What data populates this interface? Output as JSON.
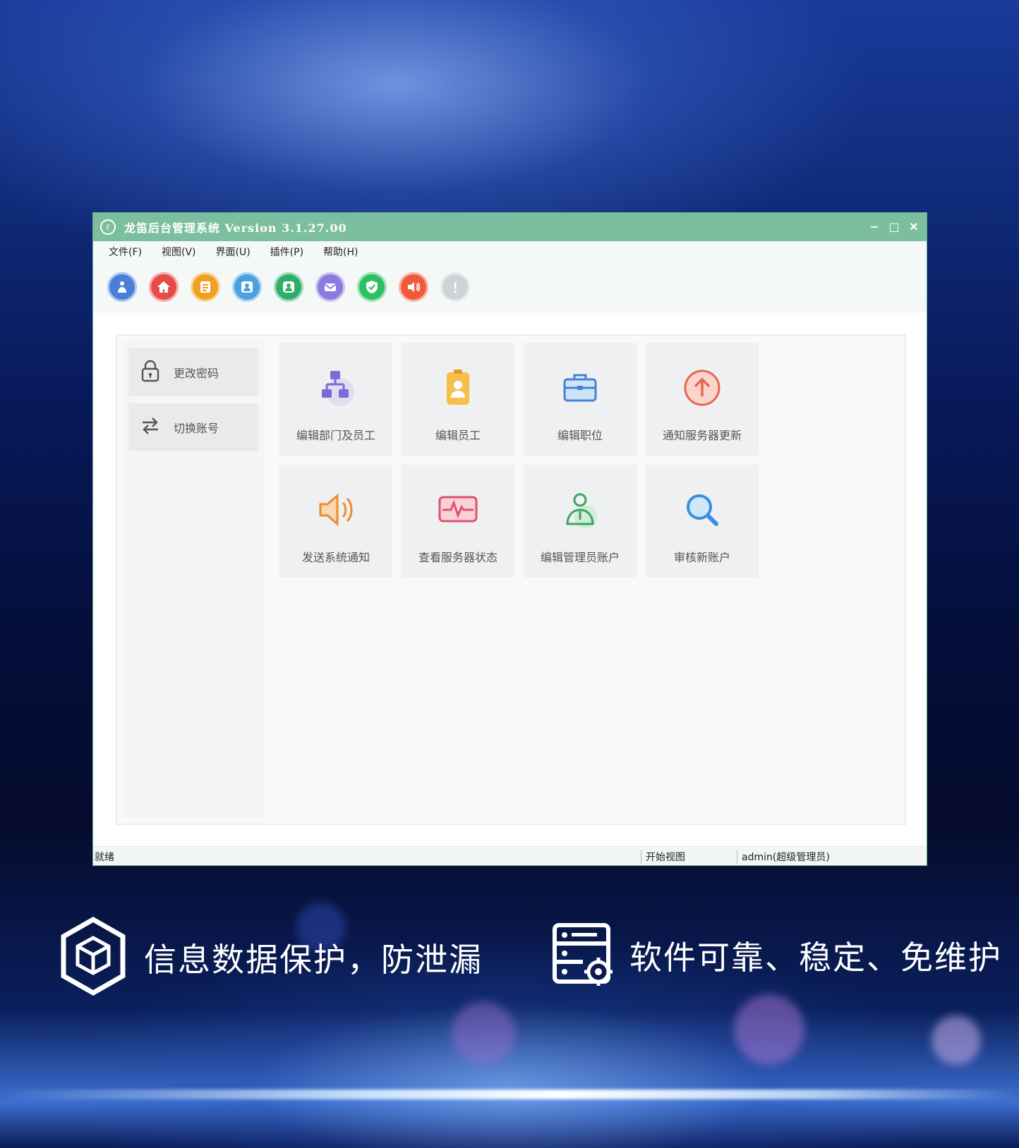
{
  "window": {
    "title": "龙笛后台管理系统 Version 3.1.27.00",
    "logo_glyph": "ℓ",
    "controls": {
      "minimize": "−",
      "maximize": "□",
      "close": "✕"
    }
  },
  "menu": [
    {
      "label": "文件(F)"
    },
    {
      "label": "视图(V)"
    },
    {
      "label": "界面(U)"
    },
    {
      "label": "插件(P)"
    },
    {
      "label": "帮助(H)"
    }
  ],
  "toolbar": [
    {
      "icon": "user-guide-icon",
      "color": "#4a7fd8"
    },
    {
      "icon": "home-icon",
      "color": "#e84a4a"
    },
    {
      "icon": "list-icon",
      "color": "#f0a020"
    },
    {
      "icon": "contact-card-icon",
      "color": "#4aa0e0"
    },
    {
      "icon": "user-card-icon",
      "color": "#2fae6a"
    },
    {
      "icon": "mail-icon",
      "color": "#8c7ae0"
    },
    {
      "icon": "shield-check-icon",
      "color": "#2cc060"
    },
    {
      "icon": "speaker-icon",
      "color": "#f05a3a"
    },
    {
      "icon": "alert-icon",
      "color": "#cfd2d6"
    }
  ],
  "sidebar": [
    {
      "label": "更改密码",
      "icon": "lock-icon"
    },
    {
      "label": "切换账号",
      "icon": "swap-arrows-icon"
    }
  ],
  "tiles": [
    {
      "label": "编辑部门及员工",
      "icon": "org-chart-icon"
    },
    {
      "label": "编辑员工",
      "icon": "badge-icon"
    },
    {
      "label": "编辑职位",
      "icon": "briefcase-icon"
    },
    {
      "label": "通知服务器更新",
      "icon": "upload-arrow-icon"
    },
    {
      "label": "发送系统通知",
      "icon": "speaker-icon"
    },
    {
      "label": "查看服务器状态",
      "icon": "pulse-monitor-icon"
    },
    {
      "label": "编辑管理员账户",
      "icon": "admin-user-icon"
    },
    {
      "label": "审核新账户",
      "icon": "search-icon"
    }
  ],
  "status": {
    "ready": "就绪",
    "view": "开始视图",
    "user": "admin(超级管理员)"
  },
  "features": [
    {
      "text": "信息数据保护，防泄漏",
      "icon": "cube-shield-icon"
    },
    {
      "text": "软件可靠、稳定、免维护",
      "icon": "server-gear-icon"
    }
  ]
}
